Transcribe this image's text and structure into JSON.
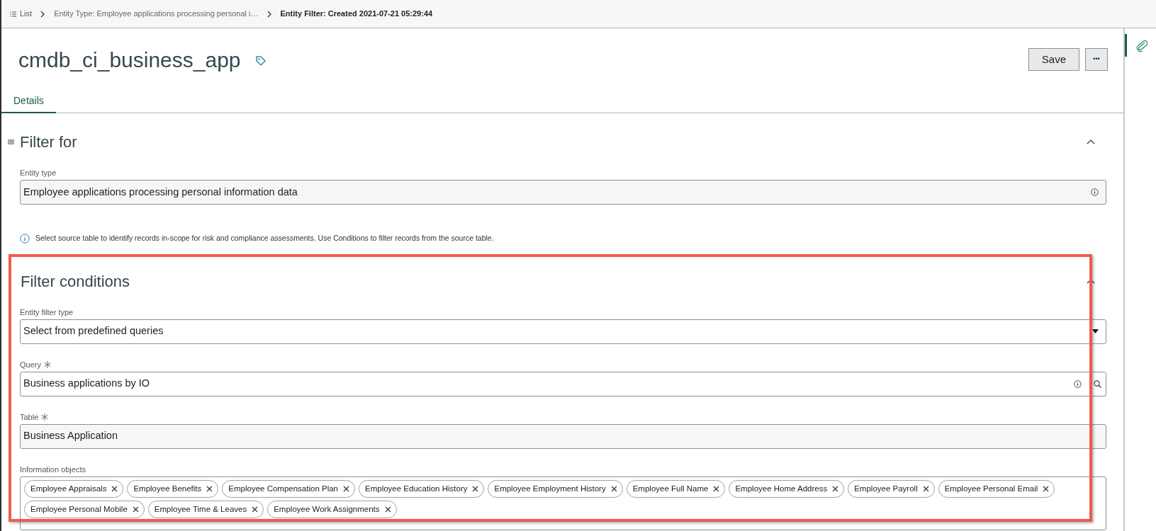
{
  "breadcrumbs": [
    {
      "label": "List",
      "kind": "list"
    },
    {
      "label": "Entity Type: Employee applications processing personal i…",
      "kind": "link"
    },
    {
      "label": "Entity Filter: Created 2021-07-21 05:29:44",
      "kind": "current"
    }
  ],
  "record": {
    "title": "cmdb_ci_business_app"
  },
  "actions": [
    {
      "label": "Save",
      "kind": "text"
    },
    {
      "label": "•••",
      "kind": "more"
    }
  ],
  "tabs": [
    {
      "label": "Details",
      "selected": true
    }
  ],
  "sections": [
    {
      "title": "Filter for",
      "expanded": true,
      "fields": [
        {
          "label": "Entity type",
          "value": "Employee applications processing personal information data",
          "kind": "readonly",
          "required": false
        }
      ],
      "note": "Select source table to identify records in-scope for risk and compliance assessments. Use Conditions to filter records from the source table."
    },
    {
      "title": "Filter conditions",
      "expanded": true,
      "fields": [
        {
          "label": "Entity filter type",
          "value": "Select from predefined queries",
          "kind": "select",
          "required": false
        },
        {
          "label": "Query",
          "value": "Business applications by IO",
          "kind": "reference",
          "required": true
        },
        {
          "label": "Table",
          "value": "Business Application",
          "kind": "display",
          "required": true
        },
        {
          "label": "Information objects",
          "kind": "tags",
          "required": false,
          "tags": [
            "Employee Appraisals",
            "Employee Benefits",
            "Employee Compensation Plan",
            "Employee Education History",
            "Employee Employment History",
            "Employee Full Name",
            "Employee Home Address",
            "Employee Payroll",
            "Employee Personal Email",
            "Employee Personal Mobile",
            "Employee Time & Leaves",
            "Employee Work Assignments"
          ]
        }
      ]
    }
  ]
}
